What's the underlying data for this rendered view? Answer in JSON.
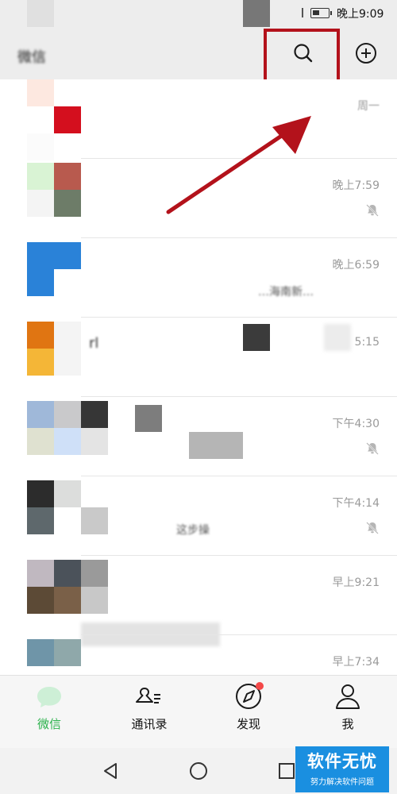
{
  "status_bar": {
    "time": "晚上9:09"
  },
  "header": {
    "title": "微信"
  },
  "chats": [
    {
      "time": "周一",
      "muted": false,
      "snippet": "",
      "avatar": [
        "#fde8e0",
        "#ffffff",
        "#ffffff",
        "#d40f1e",
        "#ffffff",
        "#ffffff"
      ]
    },
    {
      "time": "晚上7:59",
      "muted": true,
      "snippet": "",
      "avatar": [
        "#d9f3d4",
        "#b85a4e",
        "#f4f4f4",
        "#6d7c68"
      ]
    },
    {
      "time": "晚上6:59",
      "muted": false,
      "snippet": "…海南新…",
      "avatar": [
        "#2a82d8",
        "#2a82d8",
        "#2a82d8",
        "#ffffff"
      ]
    },
    {
      "time": "5:15",
      "muted": false,
      "snippet": "rl",
      "avatar": [
        "#e07512",
        "#f4f4f4",
        "#f4b637",
        "#f4f4f4"
      ]
    },
    {
      "time": "下午4:30",
      "muted": true,
      "snippet": "",
      "avatar": [
        "#9fb8d9",
        "#c9c9cb",
        "#dfe1d0",
        "#cfe0f8"
      ]
    },
    {
      "time": "下午4:14",
      "muted": true,
      "snippet": "这步操",
      "avatar": [
        "#2c2c2c",
        "#dcdddc",
        "#5e686c",
        "#ffffff"
      ]
    },
    {
      "time": "早上9:21",
      "muted": false,
      "snippet": "",
      "avatar": [
        "#c0b8c0",
        "#4b525a",
        "#5c4a36",
        "#7a6048"
      ]
    },
    {
      "time": "早上7:34",
      "muted": false,
      "snippet": "",
      "avatar": [
        "#6f95a8",
        "#8fa8aa",
        "#ffffff",
        "#ffffff"
      ]
    }
  ],
  "nav": [
    {
      "label": "微信",
      "icon": "chat-bubble-icon",
      "active": true
    },
    {
      "label": "通讯录",
      "icon": "contacts-icon",
      "active": false
    },
    {
      "label": "发现",
      "icon": "compass-icon",
      "active": false,
      "badge": true
    },
    {
      "label": "我",
      "icon": "person-icon",
      "active": false
    }
  ],
  "watermark": {
    "title": "软件无忧",
    "subtitle": "努力解决软件问题"
  },
  "colors": {
    "accent_green": "#2bb24c",
    "annotation_red": "#b3121b",
    "badge_red": "#f44848",
    "watermark_blue": "#1a8fe0"
  }
}
